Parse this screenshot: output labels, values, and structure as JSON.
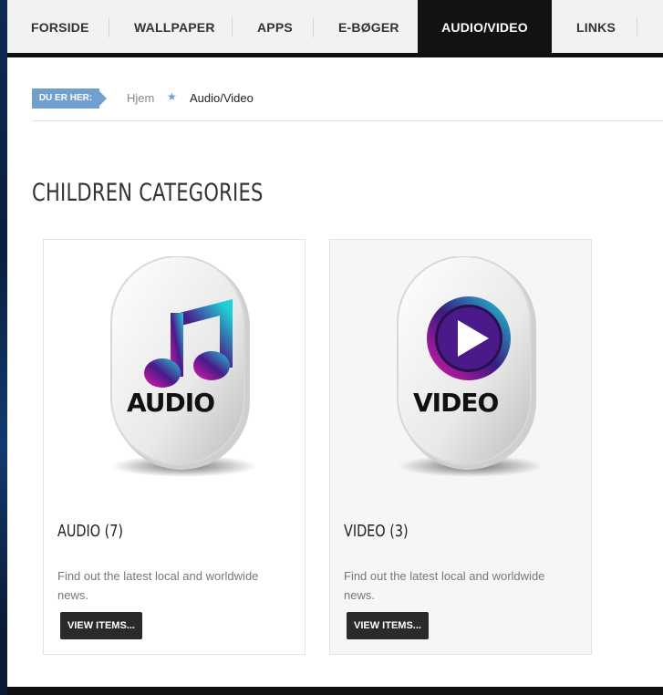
{
  "nav": {
    "items": [
      "FORSIDE",
      "WALLPAPER",
      "APPS",
      "E-BØGER",
      "AUDIO/VIDEO",
      "LINKS"
    ],
    "active": "AUDIO/VIDEO"
  },
  "breadcrumb": {
    "tag": "DU ER HER:",
    "home": "Hjem",
    "separator": "★",
    "current": "Audio/Video"
  },
  "heading": "CHILDREN CATEGORIES",
  "categories": [
    {
      "icon_label": "AUDIO",
      "title": "AUDIO (7)",
      "description": "Find out the latest local and worldwide news.",
      "button": "VIEW ITEMS..."
    },
    {
      "icon_label": "VIDEO",
      "title": "VIDEO (3)",
      "description": "Find out the latest local and worldwide news.",
      "button": "VIEW ITEMS..."
    }
  ],
  "colors": {
    "nav_active_bg": "#121212",
    "breadcrumb_tag": "#6fa0cf",
    "button_bg": "#2a2a2a"
  }
}
